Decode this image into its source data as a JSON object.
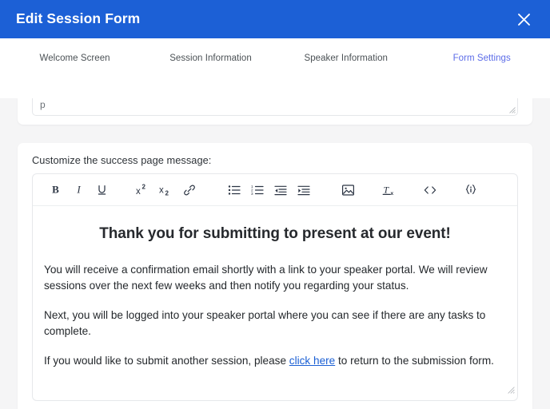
{
  "header": {
    "title": "Edit Session Form",
    "close_icon": "close-icon",
    "background_color": "#1c60d6"
  },
  "stepper": {
    "accent_color": "#5c6ce8",
    "steps": [
      {
        "label": "Welcome Screen",
        "state": "complete",
        "x_pct": 13.6
      },
      {
        "label": "Session Information",
        "state": "complete",
        "x_pct": 38.3
      },
      {
        "label": "Speaker Information",
        "state": "complete",
        "x_pct": 62.9
      },
      {
        "label": "Form Settings",
        "state": "current",
        "x_pct": 87.6
      }
    ]
  },
  "top_field": {
    "value": "p",
    "placeholder": ""
  },
  "editor_section": {
    "label": "Customize the success page message:",
    "toolbar": [
      {
        "name": "bold-icon",
        "label": "B"
      },
      {
        "name": "italic-icon",
        "label": "I"
      },
      {
        "name": "underline-icon",
        "label": "U"
      },
      {
        "name": "superscript-icon",
        "label": "x2"
      },
      {
        "name": "subscript-icon",
        "label": "x2"
      },
      {
        "name": "link-icon",
        "label": "Link"
      },
      {
        "name": "bulleted-list-icon",
        "label": "Bulleted list"
      },
      {
        "name": "numbered-list-icon",
        "label": "Numbered list"
      },
      {
        "name": "outdent-icon",
        "label": "Decrease indent"
      },
      {
        "name": "indent-icon",
        "label": "Increase indent"
      },
      {
        "name": "image-icon",
        "label": "Insert image"
      },
      {
        "name": "clear-formatting-icon",
        "label": "Clear formatting"
      },
      {
        "name": "code-icon",
        "label": "Source code"
      },
      {
        "name": "merge-tag-icon",
        "label": "Merge tags"
      }
    ],
    "document": {
      "heading": "Thank you for submitting to present at our event!",
      "paragraph_1": "You will receive a confirmation email shortly with a link to your speaker portal. We will review sessions over the next few weeks and then notify you regarding your status.",
      "paragraph_2": "Next, you will be logged into your speaker portal where you can see if there are any tasks to complete.",
      "paragraph_3_before": "If you would like to submit another session, please ",
      "paragraph_3_link": "click here",
      "paragraph_3_after": " to return to the submission form.",
      "link_color": "#1a5fd4"
    }
  }
}
